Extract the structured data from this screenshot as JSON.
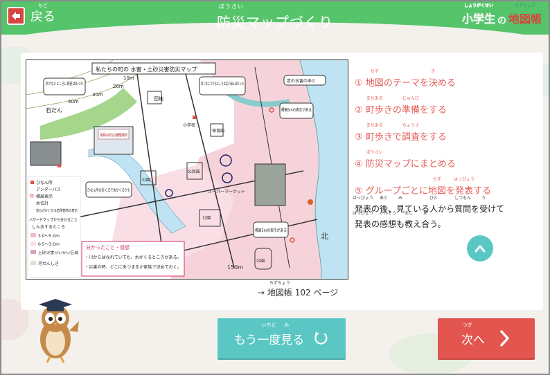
{
  "header": {
    "back": {
      "text": "戻る",
      "ruby": "もど"
    },
    "title": {
      "pre": "",
      "kanji": "防災",
      "ruby": "ぼうさい",
      "post": "マップづくり"
    },
    "brand": {
      "part1": "小学生",
      "part1_ruby": "しょうがくせい",
      "particle": "の",
      "part2": "地図帳",
      "part2_ruby": "ちずちょう"
    }
  },
  "map": {
    "title": "私たちの町の 水害・土砂災害防災マップ",
    "labels": {
      "no_water": "水がないところに鉄柱はあった",
      "flood_road": "深く水につかるところは広い田んぼだった",
      "old_mark": "昔の水害のあと",
      "mark_place": "標高5mの表示がある",
      "refuge_near": "ひなん所の近くまで水がくるかも",
      "mark_place2": "標高5mの表示がある",
      "stone_wall": "石だん",
      "park": "公園",
      "park2": "公園",
      "park3": "公園",
      "hall": "公民館",
      "school": "小学校",
      "kindergarten": "保育園",
      "supermarket": "スーパーマーケット",
      "danchi": "団地",
      "scale": "150m",
      "north": "北",
      "contours": [
        "40m",
        "30m",
        "20m",
        "10m"
      ]
    },
    "legend": {
      "items": [
        "ひなん所",
        "アンダーパス",
        "標高表示",
        "水位計",
        "急ながけとなる危険箇所の表示"
      ],
      "hazard_title": "ハザードマップから分かること",
      "hazard_sub": "しん水するところ",
      "depth1": "3.0〜5.0m",
      "depth2": "0.5〜3.0m",
      "landslide": "土砂災害けいかい区域",
      "river": "河せんしき"
    },
    "findings": {
      "title": "分かったこと・感想",
      "lines": [
        "・川からはなれていても、水がくるところがある。",
        "・災害の時、どこにあつまるか家族で決めておく。"
      ]
    },
    "photo_sign": "湯殿山防災避難場所"
  },
  "caption": {
    "arrow": "→",
    "text1": "地図帳",
    "ruby": "ちずちょう",
    "text2": " 102 ページ"
  },
  "steps": [
    {
      "num": "①",
      "parts": [
        {
          "t": "地図"
        },
        {
          "t": "の"
        },
        {
          "t": "テーマを"
        },
        {
          "t": "決",
          "r": "き"
        },
        {
          "t": "める"
        }
      ],
      "ruby_map": {
        "地図": "ちず"
      }
    },
    {
      "num": "②",
      "parts": [
        {
          "t": "町歩",
          "r": "まちある"
        },
        {
          "t": "きの"
        },
        {
          "t": "準備",
          "r": "じゅんび"
        },
        {
          "t": "をする"
        }
      ]
    },
    {
      "num": "③",
      "parts": [
        {
          "t": "町歩",
          "r": "まちある"
        },
        {
          "t": "きで"
        },
        {
          "t": "調査",
          "r": "ちょうさ"
        },
        {
          "t": "をする"
        }
      ]
    },
    {
      "num": "④",
      "parts": [
        {
          "t": "防災",
          "r": "ぼうさい"
        },
        {
          "t": "マップにまとめる"
        }
      ]
    },
    {
      "num": "⑤",
      "parts": [
        {
          "t": "グループごとに"
        },
        {
          "t": "地図",
          "r": "ちず"
        },
        {
          "t": "を"
        },
        {
          "t": "発表",
          "r": "はっぴょう"
        },
        {
          "t": "する"
        }
      ]
    }
  ],
  "description": {
    "line1": [
      {
        "t": "発表",
        "r": "はっぴょう"
      },
      {
        "t": "の"
      },
      {
        "t": "後",
        "r": "あと"
      },
      {
        "t": "、"
      },
      {
        "t": "見",
        "r": "み"
      },
      {
        "t": "ている"
      },
      {
        "t": "人",
        "r": "ひと"
      },
      {
        "t": "から"
      },
      {
        "t": "質問",
        "r": "しつもん"
      },
      {
        "t": "を"
      },
      {
        "t": "受",
        "r": "う"
      },
      {
        "t": "けて"
      }
    ],
    "line2": [
      {
        "t": "発表",
        "r": "はっぴょう"
      },
      {
        "t": "の"
      },
      {
        "t": "感想",
        "r": "かんそう"
      },
      {
        "t": "も"
      },
      {
        "t": "教",
        "r": "おし"
      },
      {
        "t": "え"
      },
      {
        "t": "合",
        "r": "あ"
      },
      {
        "t": "う。"
      }
    ]
  },
  "buttons": {
    "replay": {
      "pre": "もう",
      "kanji": "一度",
      "ruby": "いちど",
      "mid": "",
      "kanji2": "見",
      "ruby2": "み",
      "post": "る"
    },
    "next": {
      "kanji": "次",
      "ruby": "つぎ",
      "post": "へ"
    }
  },
  "colors": {
    "header": "#56c46b",
    "accent": "#e45b56",
    "teal": "#5bc7c4",
    "next": "#e2564f"
  }
}
